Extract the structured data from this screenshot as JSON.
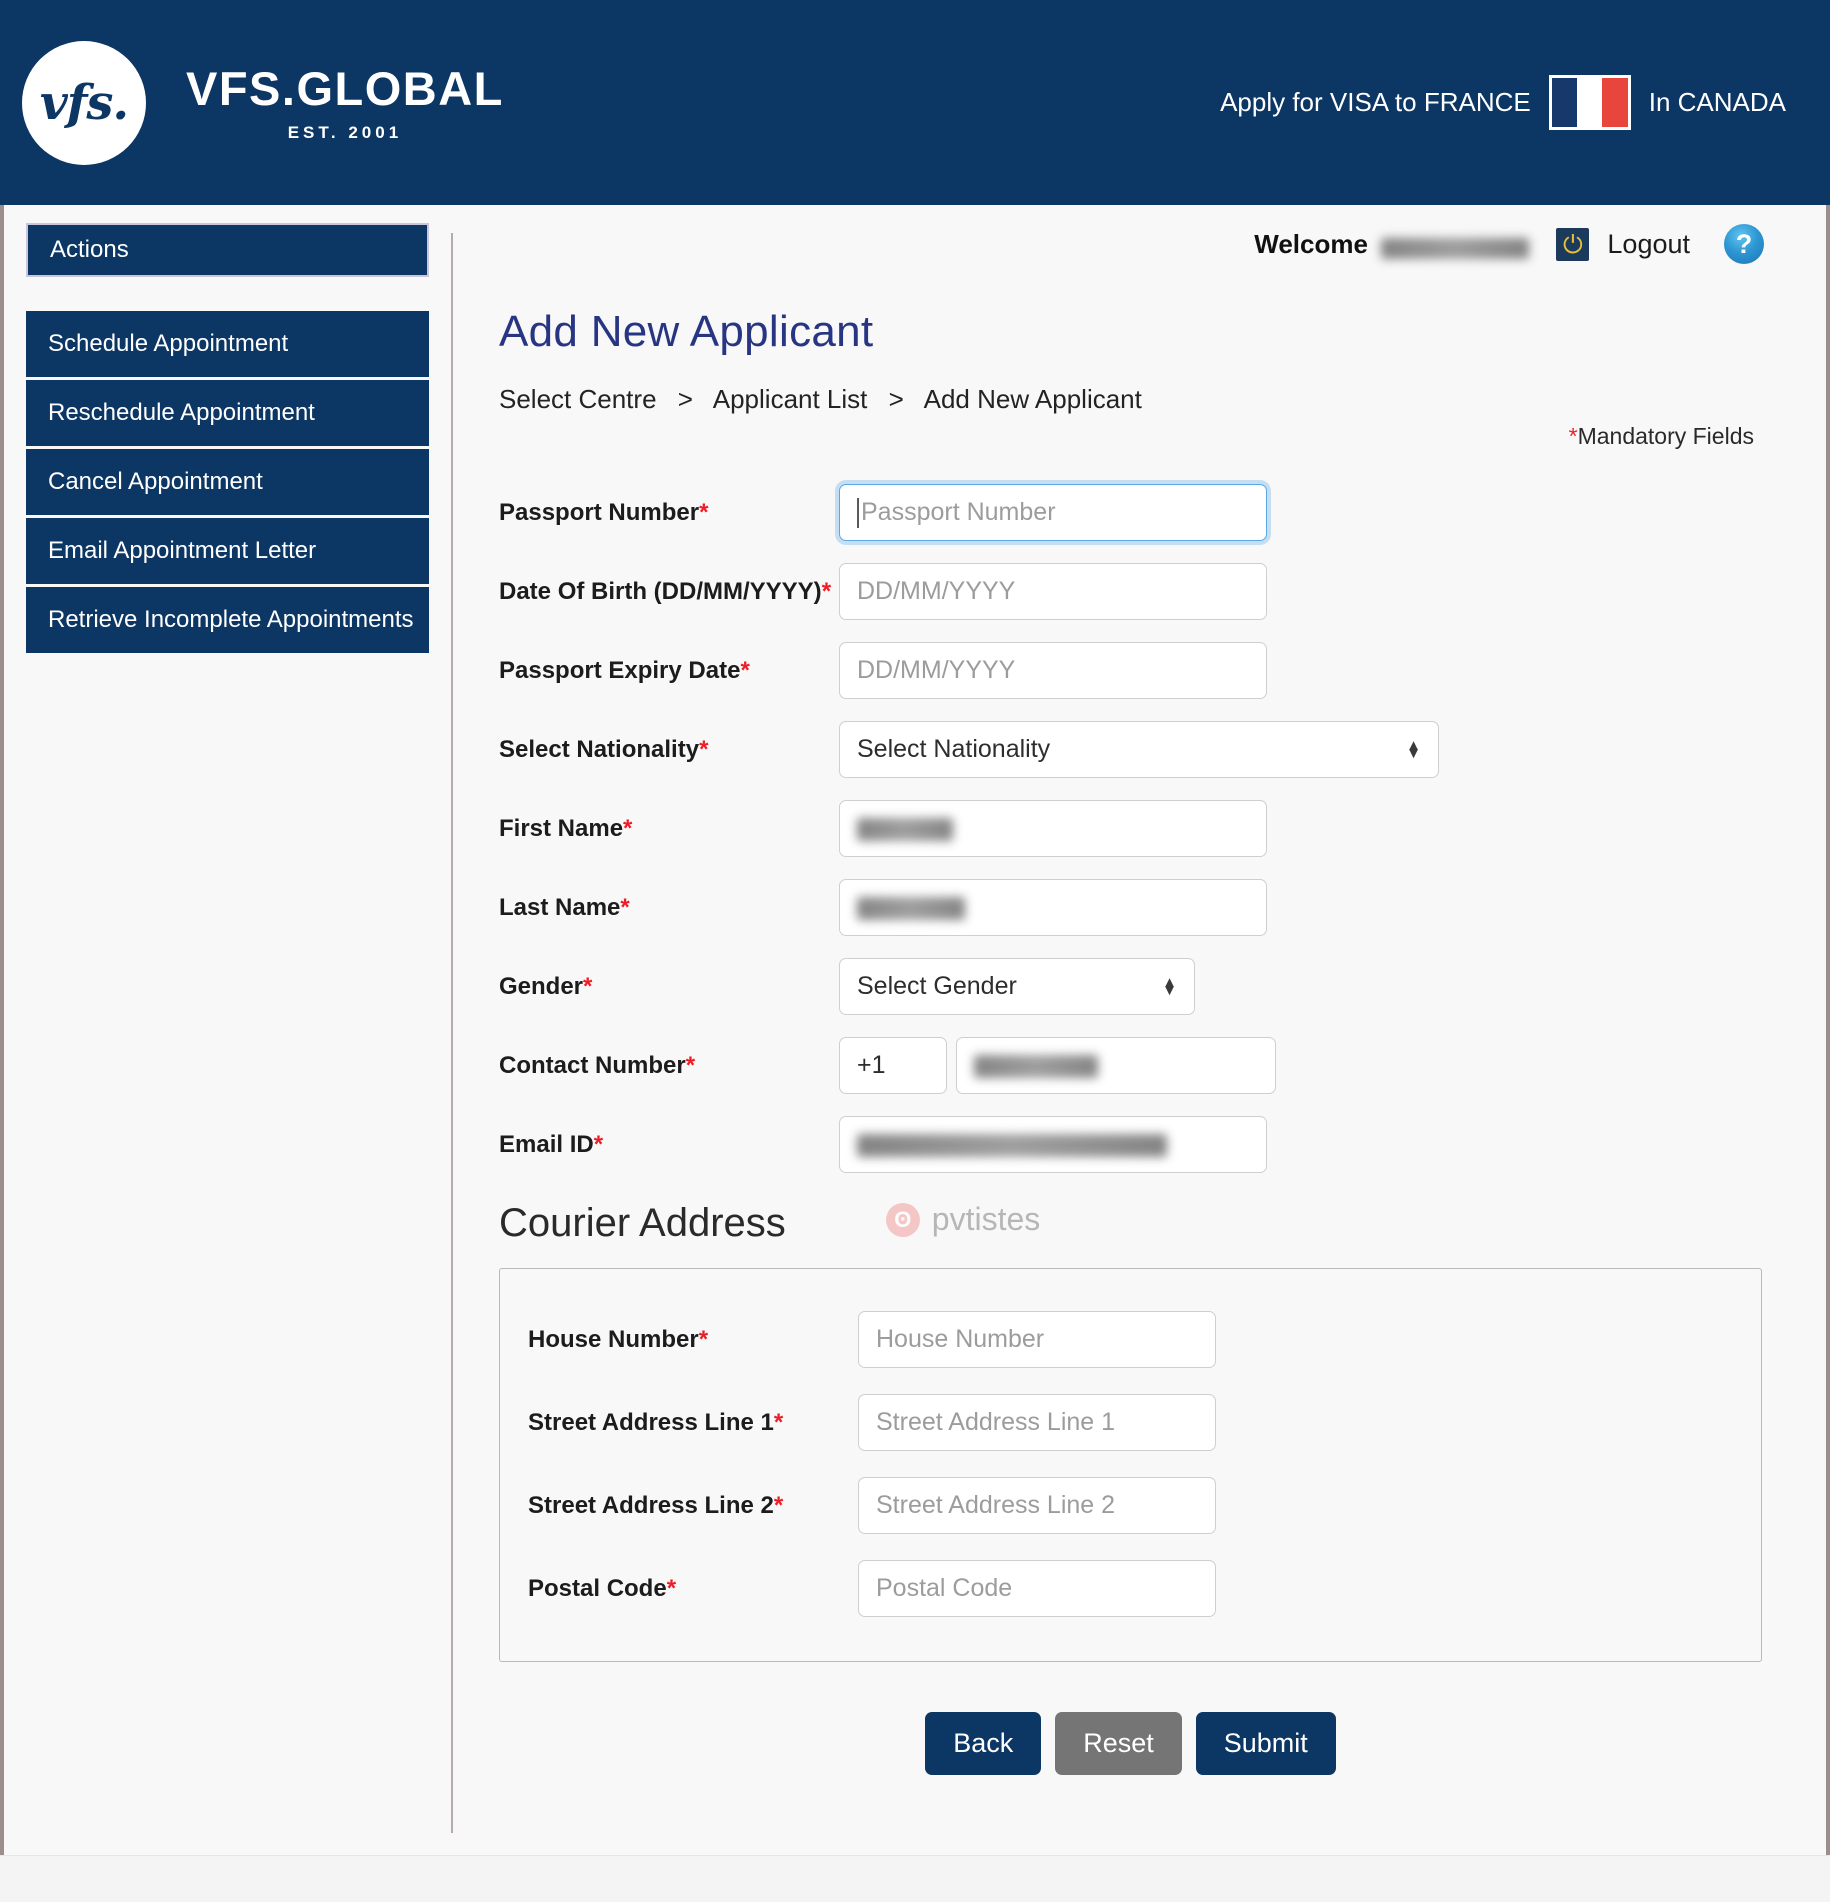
{
  "brand": {
    "logo_mark": "vfs.",
    "logo_name": "VFS.GLOBAL",
    "logo_est": "EST. 2001",
    "apply_text": "Apply for VISA to FRANCE",
    "in_country": "In CANADA",
    "flag_name": "france-flag-icon",
    "navy": "#0c3663"
  },
  "userbar": {
    "welcome_label": "Welcome",
    "user_name_redacted": true,
    "logout_label": "Logout",
    "power_icon": "power-icon",
    "help_icon": "help-icon",
    "help_glyph": "?"
  },
  "sidebar": {
    "header": "Actions",
    "items": [
      {
        "label": "Schedule Appointment"
      },
      {
        "label": "Reschedule Appointment"
      },
      {
        "label": "Cancel Appointment"
      },
      {
        "label": "Email Appointment Letter"
      },
      {
        "label": "Retrieve Incomplete Appointments"
      }
    ]
  },
  "main": {
    "title": "Add New Applicant",
    "breadcrumb": [
      "Select Centre",
      "Applicant List",
      "Add New Applicant"
    ],
    "breadcrumb_sep": ">",
    "mandatory_note": "Mandatory Fields",
    "required_marker": "*"
  },
  "form": {
    "passport_number": {
      "label": "Passport Number",
      "placeholder": "Passport Number",
      "value": "",
      "focused": true
    },
    "date_of_birth": {
      "label": "Date Of Birth (DD/MM/YYYY)",
      "placeholder": "DD/MM/YYYY",
      "value": ""
    },
    "passport_expiry": {
      "label": "Passport Expiry Date",
      "placeholder": "DD/MM/YYYY",
      "value": ""
    },
    "nationality": {
      "label": "Select Nationality",
      "selected": "Select Nationality"
    },
    "first_name": {
      "label": "First Name",
      "value_redacted": true
    },
    "last_name": {
      "label": "Last Name",
      "value_redacted": true
    },
    "gender": {
      "label": "Gender",
      "selected": "Select Gender"
    },
    "contact_number": {
      "label": "Contact Number",
      "country_code": "+1",
      "value_redacted": true
    },
    "email_id": {
      "label": "Email ID",
      "value_redacted": true
    }
  },
  "courier": {
    "title": "Courier Address",
    "watermark_text": "pvtistes",
    "watermark_glyph": "ʘ",
    "fields": {
      "house_number": {
        "label": "House Number",
        "placeholder": "House Number",
        "value": ""
      },
      "street_line_1": {
        "label": "Street Address Line 1",
        "placeholder": "Street Address Line 1",
        "value": ""
      },
      "street_line_2": {
        "label": "Street Address Line 2",
        "placeholder": "Street Address Line 2",
        "value": ""
      },
      "postal_code": {
        "label": "Postal Code",
        "placeholder": "Postal Code",
        "value": ""
      }
    }
  },
  "buttons": {
    "back": "Back",
    "reset": "Reset",
    "submit": "Submit"
  }
}
